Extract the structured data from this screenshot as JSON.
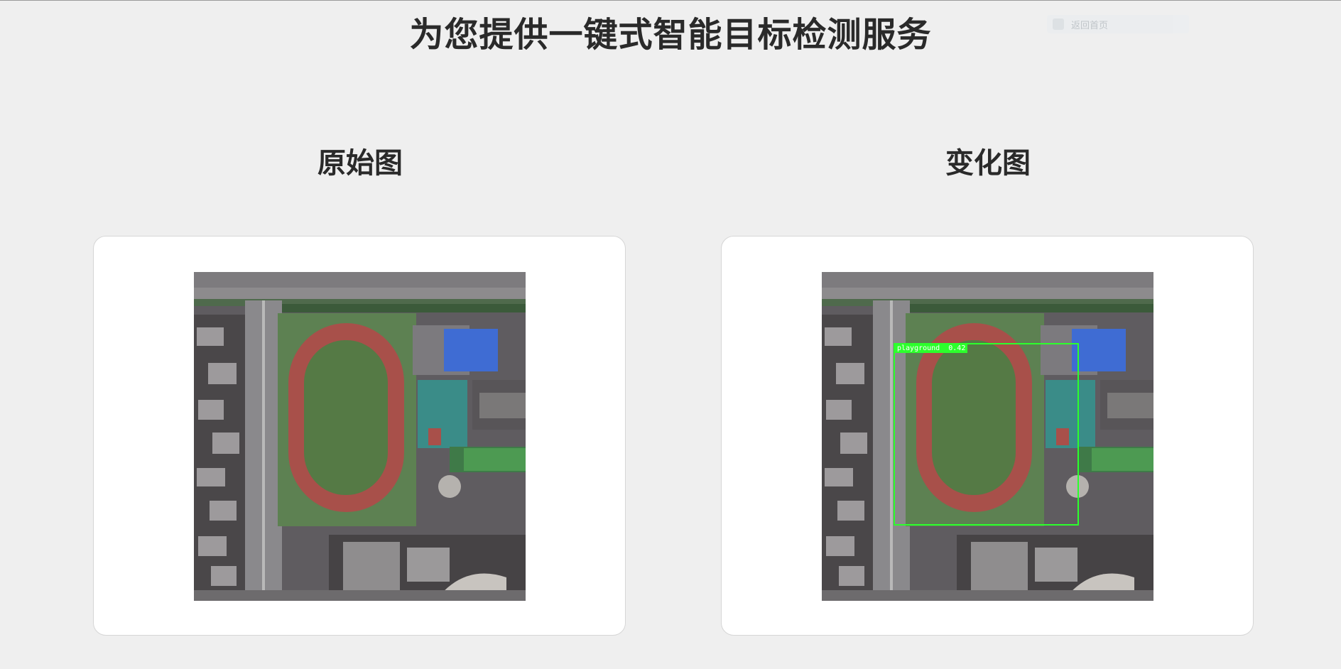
{
  "header": {
    "title": "为您提供一键式智能目标检测服务",
    "corner_chip_text": "返回首页"
  },
  "panels": [
    {
      "title": "原始图",
      "image_alt": "aerial view of school campus with running track"
    },
    {
      "title": "变化图",
      "image_alt": "aerial view with detection result"
    }
  ],
  "detection": {
    "label": "playground",
    "score": "0.42",
    "color": "#2cff2c"
  },
  "colors": {
    "background": "#efefef",
    "card": "#ffffff",
    "track": "#a8504a",
    "field": "#547a44",
    "roof_blue": "#3f6cd3",
    "court_teal": "#3a8c88"
  }
}
